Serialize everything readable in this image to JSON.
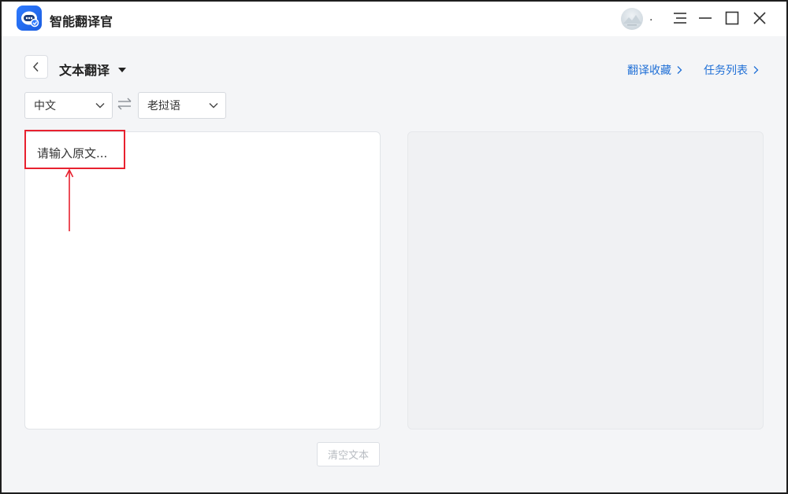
{
  "app": {
    "title": "智能翻译官"
  },
  "header": {
    "avatar_suffix": "."
  },
  "toolbar": {
    "mode_title": "文本翻译",
    "links": {
      "favorites": "翻译收藏",
      "tasks": "任务列表"
    }
  },
  "languages": {
    "source": "中文",
    "target": "老挝语"
  },
  "source_panel": {
    "placeholder": "请输入原文..."
  },
  "actions": {
    "clear_label": "清空文本"
  },
  "colors": {
    "accent": "#1f6fd6",
    "annotation": "#e8212f",
    "logo": "#2f7bff"
  }
}
